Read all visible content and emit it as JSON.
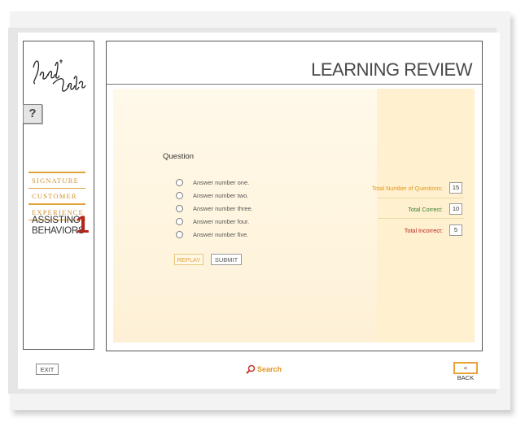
{
  "sidebar": {
    "logo_text": "Lord & Taylor",
    "signature_lines": [
      "SIGNATURE",
      "CUSTOMER",
      "EXPERIENCE"
    ],
    "course_lines": [
      "ASSISTING",
      "BEHAVIORS"
    ],
    "course_number": "1"
  },
  "header": {
    "title": "LEARNING REVIEW"
  },
  "question": {
    "icon_glyph": "?",
    "label": "Question",
    "answers": [
      "Answer number one.",
      "Answer number two.",
      "Answer number three.",
      "Answer number four.",
      "Answer number five."
    ],
    "selected": null
  },
  "buttons": {
    "replay": "REPLAY",
    "submit": "SUBMIT"
  },
  "stats": {
    "total_questions_label": "Total Number of Questions:",
    "total_questions_value": "15",
    "total_correct_label": "Total Correct:",
    "total_correct_value": "10",
    "total_incorrect_label": "Total Incorrect:",
    "total_incorrect_value": "5"
  },
  "footer": {
    "exit": "EXIT",
    "search": "Search",
    "back": "< BACK"
  },
  "colors": {
    "accent": "#e0961f",
    "correct": "#3a7d2c",
    "incorrect": "#b3261e",
    "number": "#b3261e"
  }
}
